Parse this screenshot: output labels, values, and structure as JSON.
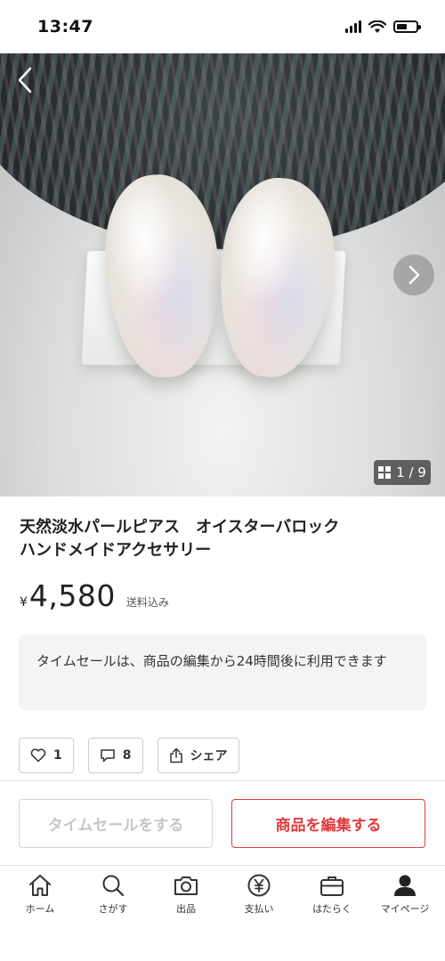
{
  "status_bar": {
    "time": "13:47"
  },
  "gallery": {
    "counter": "1 / 9"
  },
  "product": {
    "title_line1": "天然淡水パールピアス　オイスターバロック",
    "title_line2": "ハンドメイドアクセサリー",
    "currency": "¥",
    "price": "4,580",
    "shipping": "送料込み"
  },
  "notice": {
    "text": "タイムセールは、商品の編集から24時間後に利用できます"
  },
  "actions": {
    "like_count": "1",
    "comment_count": "8",
    "share_label": "シェア"
  },
  "buttons": {
    "timesale_label": "タイムセールをする",
    "edit_label": "商品を編集する"
  },
  "tabbar": {
    "items": [
      {
        "label": "ホーム",
        "icon": "home-icon"
      },
      {
        "label": "さがす",
        "icon": "search-icon"
      },
      {
        "label": "出品",
        "icon": "camera-icon"
      },
      {
        "label": "支払い",
        "icon": "yen-icon"
      },
      {
        "label": "はたらく",
        "icon": "briefcase-icon"
      },
      {
        "label": "マイページ",
        "icon": "person-icon"
      }
    ]
  },
  "colors": {
    "accent_red": "#e03a3a",
    "disabled_text": "#c6c6c6",
    "notice_bg": "#f4f4f4"
  }
}
